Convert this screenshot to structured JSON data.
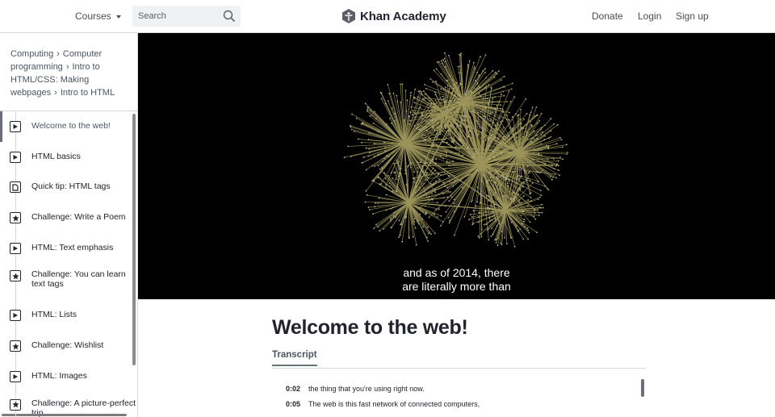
{
  "header": {
    "courses_label": "Courses",
    "search_placeholder": "Search",
    "logo_text": "Khan Academy",
    "donate_label": "Donate",
    "login_label": "Login",
    "signup_label": "Sign up"
  },
  "breadcrumb": {
    "items": [
      "Computing",
      "Computer programming",
      "Intro to HTML/CSS: Making webpages",
      "Intro to HTML"
    ],
    "separator": "›"
  },
  "lessons": [
    {
      "label": "Welcome to the web!",
      "type": "video",
      "icon": "play-icon",
      "active": true
    },
    {
      "label": "HTML basics",
      "type": "video",
      "icon": "play-icon"
    },
    {
      "label": "Quick tip: HTML tags",
      "type": "article",
      "icon": "document-icon"
    },
    {
      "label": "Challenge: Write a Poem",
      "type": "challenge",
      "icon": "star-icon"
    },
    {
      "label": "HTML: Text emphasis",
      "type": "video",
      "icon": "play-icon"
    },
    {
      "label": "Challenge: You can learn text tags",
      "type": "challenge",
      "icon": "star-icon"
    },
    {
      "label": "HTML: Lists",
      "type": "video",
      "icon": "play-icon"
    },
    {
      "label": "Challenge: Wishlist",
      "type": "challenge",
      "icon": "star-icon"
    },
    {
      "label": "HTML: Images",
      "type": "video",
      "icon": "play-icon"
    },
    {
      "label": "Challenge: A picture-perfect trip",
      "type": "challenge",
      "icon": "star-icon"
    }
  ],
  "video": {
    "caption_line1": "and as of 2014, there",
    "caption_line2": "are literally more than",
    "graph_color": "#b7ae6a"
  },
  "main": {
    "title": "Welcome to the web!",
    "tab_transcript": "Transcript",
    "transcript": [
      {
        "time": "0:02",
        "text": "the thing that you're using right now."
      },
      {
        "time": "0:05",
        "text": "The web is this fast network of connected computers,"
      }
    ]
  },
  "colors": {
    "text": "#21242c",
    "muted": "#4b5563",
    "border": "#d6d8da",
    "video_bg": "#000000"
  }
}
